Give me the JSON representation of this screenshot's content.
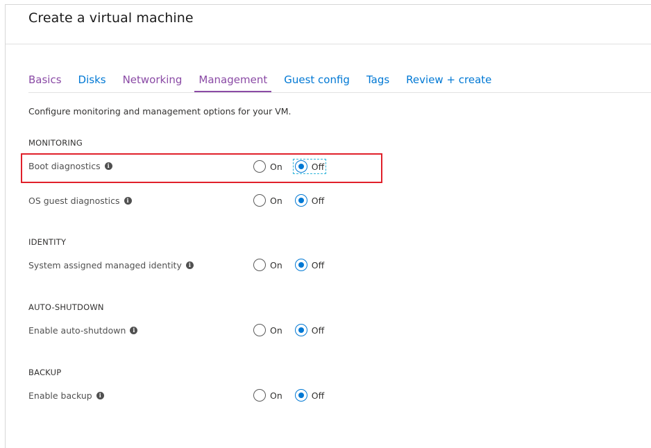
{
  "header": {
    "title": "Create a virtual machine"
  },
  "tabs": [
    {
      "label": "Basics",
      "state": "visited"
    },
    {
      "label": "Disks",
      "state": "default"
    },
    {
      "label": "Networking",
      "state": "visited"
    },
    {
      "label": "Management",
      "state": "active"
    },
    {
      "label": "Guest config",
      "state": "default"
    },
    {
      "label": "Tags",
      "state": "default"
    },
    {
      "label": "Review + create",
      "state": "default"
    }
  ],
  "description": "Configure monitoring and management options for your VM.",
  "sections": {
    "monitoring": {
      "title": "MONITORING",
      "boot_diagnostics": {
        "label": "Boot diagnostics",
        "on": "On",
        "off": "Off",
        "selected": "Off"
      },
      "os_guest_diagnostics": {
        "label": "OS guest diagnostics",
        "on": "On",
        "off": "Off",
        "selected": "Off"
      }
    },
    "identity": {
      "title": "IDENTITY",
      "system_identity": {
        "label": "System assigned managed identity",
        "on": "On",
        "off": "Off",
        "selected": "Off"
      }
    },
    "auto_shutdown": {
      "title": "AUTO-SHUTDOWN",
      "enable": {
        "label": "Enable auto-shutdown",
        "on": "On",
        "off": "Off",
        "selected": "Off"
      }
    },
    "backup": {
      "title": "BACKUP",
      "enable": {
        "label": "Enable backup",
        "on": "On",
        "off": "Off",
        "selected": "Off"
      }
    }
  },
  "icons": {
    "info": "info-icon"
  },
  "colors": {
    "accent": "#0078d4",
    "tab_active": "#8a4aa5",
    "highlight": "#e0202a"
  }
}
